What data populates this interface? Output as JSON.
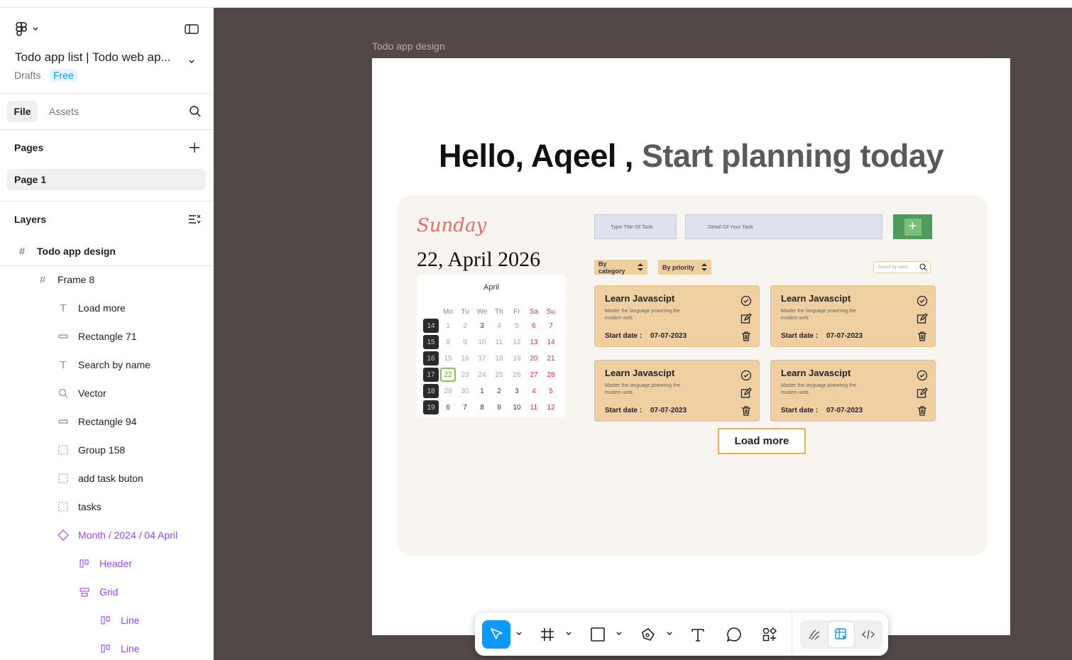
{
  "file": {
    "title": "Todo app list | Todo web ap...",
    "location": "Drafts",
    "plan_badge": "Free"
  },
  "tabs": {
    "file": "File",
    "assets": "Assets"
  },
  "pages": {
    "label": "Pages",
    "items": [
      "Page 1"
    ]
  },
  "layers": {
    "label": "Layers",
    "items": [
      {
        "label": "Todo app design",
        "icon": "frame-icon"
      },
      {
        "label": "Frame 8",
        "icon": "frame-icon"
      },
      {
        "label": "Load more",
        "icon": "text-icon"
      },
      {
        "label": "Rectangle 71",
        "icon": "rectangle-icon"
      },
      {
        "label": "Search by name",
        "icon": "text-icon"
      },
      {
        "label": "Vector",
        "icon": "vector-search-icon"
      },
      {
        "label": "Rectangle 94",
        "icon": "rectangle-icon"
      },
      {
        "label": "Group 158",
        "icon": "group-icon"
      },
      {
        "label": "add task buton",
        "icon": "group-icon"
      },
      {
        "label": "tasks",
        "icon": "group-icon"
      },
      {
        "label": "Month / 2024 / 04 April",
        "icon": "component-instance-icon"
      },
      {
        "label": "Header",
        "icon": "auto-layout-horizontal-icon"
      },
      {
        "label": "Grid",
        "icon": "auto-layout-vertical-icon"
      },
      {
        "label": "Line",
        "icon": "auto-layout-horizontal-icon"
      },
      {
        "label": "Line",
        "icon": "auto-layout-horizontal-icon"
      }
    ]
  },
  "canvas": {
    "frame_label": "Todo app design",
    "headline_part1": "Hello, Aqeel ,",
    "headline_part2": "Start planning today",
    "weekday": "Sunday",
    "date": "22, April 2026",
    "calendar": {
      "month": "April",
      "weekdays": [
        "Mo",
        "Tu",
        "We",
        "Th",
        "Fr",
        "Sa",
        "Su"
      ],
      "weeks": [
        {
          "num": "14",
          "days": [
            "1",
            "2",
            "3",
            "4",
            "5",
            "6",
            "7"
          ]
        },
        {
          "num": "15",
          "days": [
            "8",
            "9",
            "10",
            "11",
            "12",
            "13",
            "14"
          ]
        },
        {
          "num": "16",
          "days": [
            "15",
            "16",
            "17",
            "18",
            "19",
            "20",
            "21"
          ]
        },
        {
          "num": "17",
          "days": [
            "22",
            "23",
            "24",
            "25",
            "26",
            "27",
            "28"
          ]
        },
        {
          "num": "18",
          "days": [
            "29",
            "30",
            "1",
            "2",
            "3",
            "4",
            "5"
          ]
        },
        {
          "num": "19",
          "days": [
            "6",
            "7",
            "8",
            "9",
            "10",
            "11",
            "12"
          ]
        }
      ],
      "selected": "22"
    },
    "inputs": {
      "title_placeholder": "Type Title Of Task",
      "detail_placeholder": "Detail Of Your Task"
    },
    "add_button_glyph": "+",
    "filters": {
      "category": "By category",
      "priority": "By priority"
    },
    "search_placeholder": "Search by name",
    "tasks": [
      {
        "title": "Learn Javascipt",
        "desc": "Master the language powering the modern web.",
        "start_label": "Start date :",
        "date": "07-07-2023"
      },
      {
        "title": "Learn Javascipt",
        "desc": "Master the language powering the modern web.",
        "start_label": "Start date :",
        "date": "07-07-2023"
      },
      {
        "title": "Learn Javascipt",
        "desc": "Master the language powering the modern web.",
        "start_label": "Start date :",
        "date": "07-07-2023"
      },
      {
        "title": "Learn Javascipt",
        "desc": "Master the language powering the modern web.",
        "start_label": "Start date :",
        "date": "07-07-2023"
      }
    ],
    "load_more": "Load more"
  },
  "toolbar": {
    "tools": [
      "move-icon",
      "frame-icon",
      "rectangle-icon",
      "pen-icon",
      "text-icon",
      "comment-icon",
      "actions-icon"
    ],
    "modes": [
      "draw-icon",
      "design-icon",
      "dev-mode-icon"
    ]
  },
  "colors": {
    "canvas_bg": "#524847",
    "accent_blue": "#0d99ff",
    "component_purple": "#9747ff",
    "task_card": "#f0d0a3",
    "add_button": "#4f9a5c",
    "load_more_border": "#f0b04a"
  }
}
